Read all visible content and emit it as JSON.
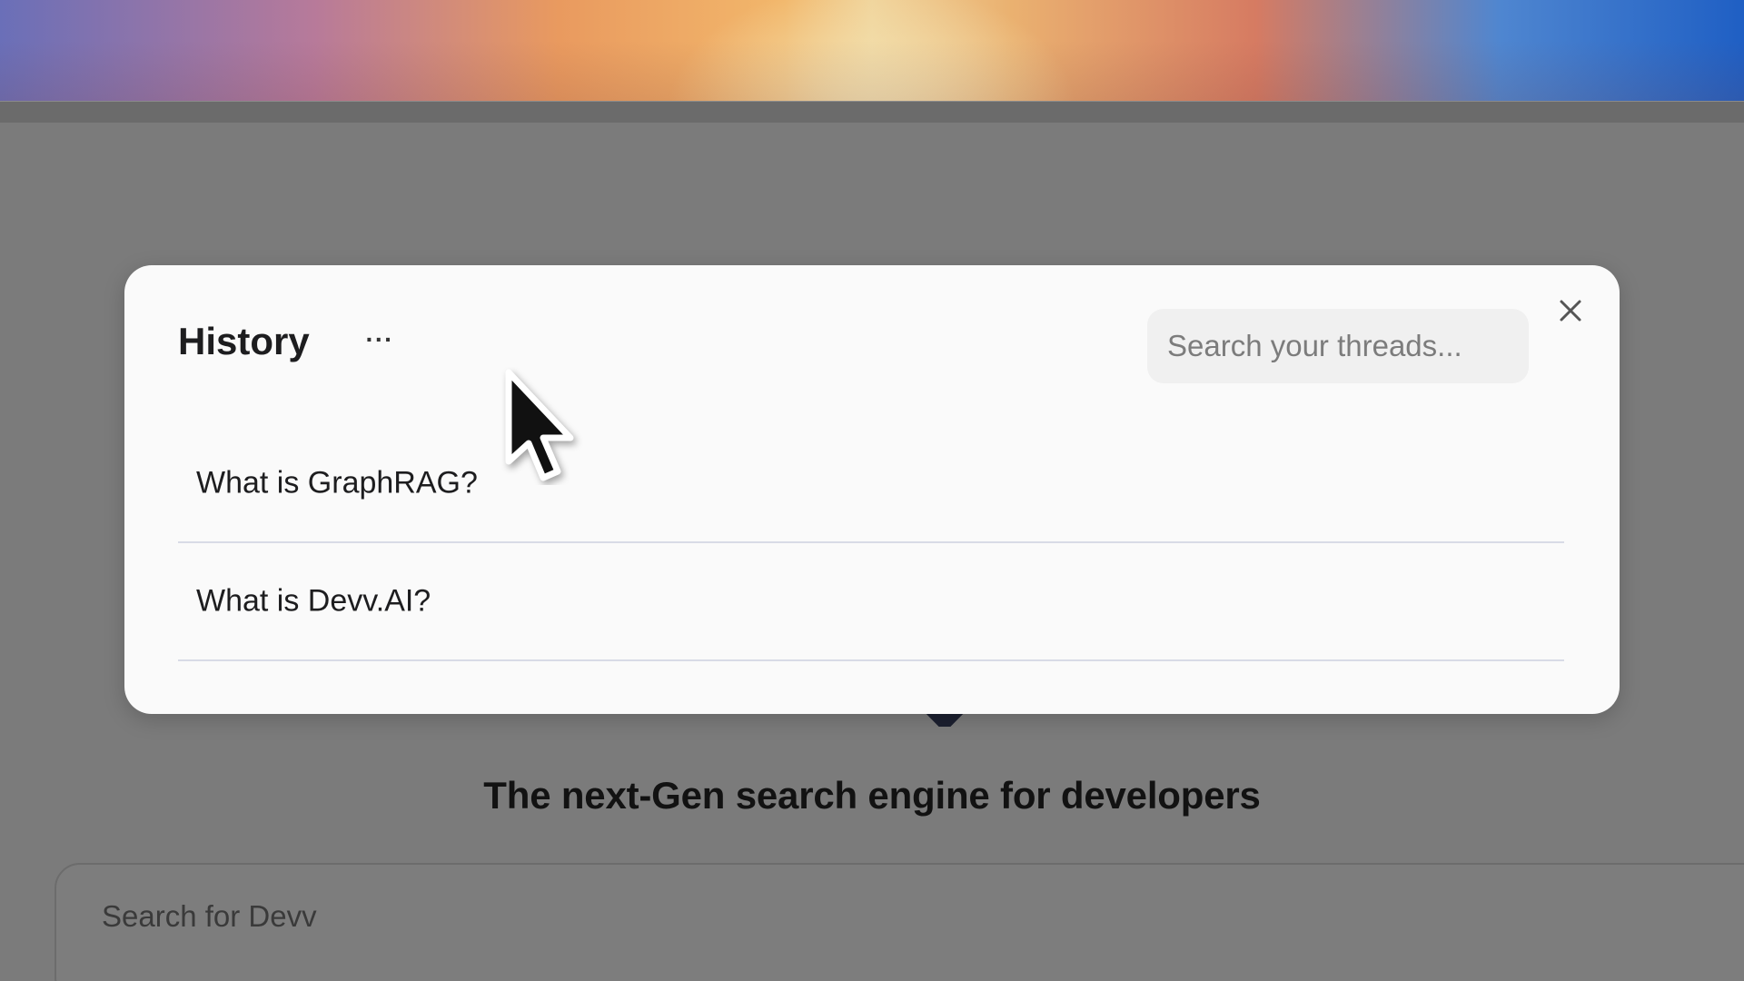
{
  "history_modal": {
    "title": "History",
    "more_label": "···",
    "search_placeholder": "Search your threads...",
    "close_icon": "close-icon",
    "threads": [
      {
        "label": "What is GraphRAG?"
      },
      {
        "label": "What is Devv.AI?"
      }
    ]
  },
  "main": {
    "tagline": "The next-Gen search engine for developers",
    "search_placeholder": "Search for Devv"
  },
  "colors": {
    "overlay": "#7a7a7a",
    "modal_bg": "#fafafa",
    "search_bg": "#f0f0f0",
    "divider": "#d8dbe6"
  }
}
